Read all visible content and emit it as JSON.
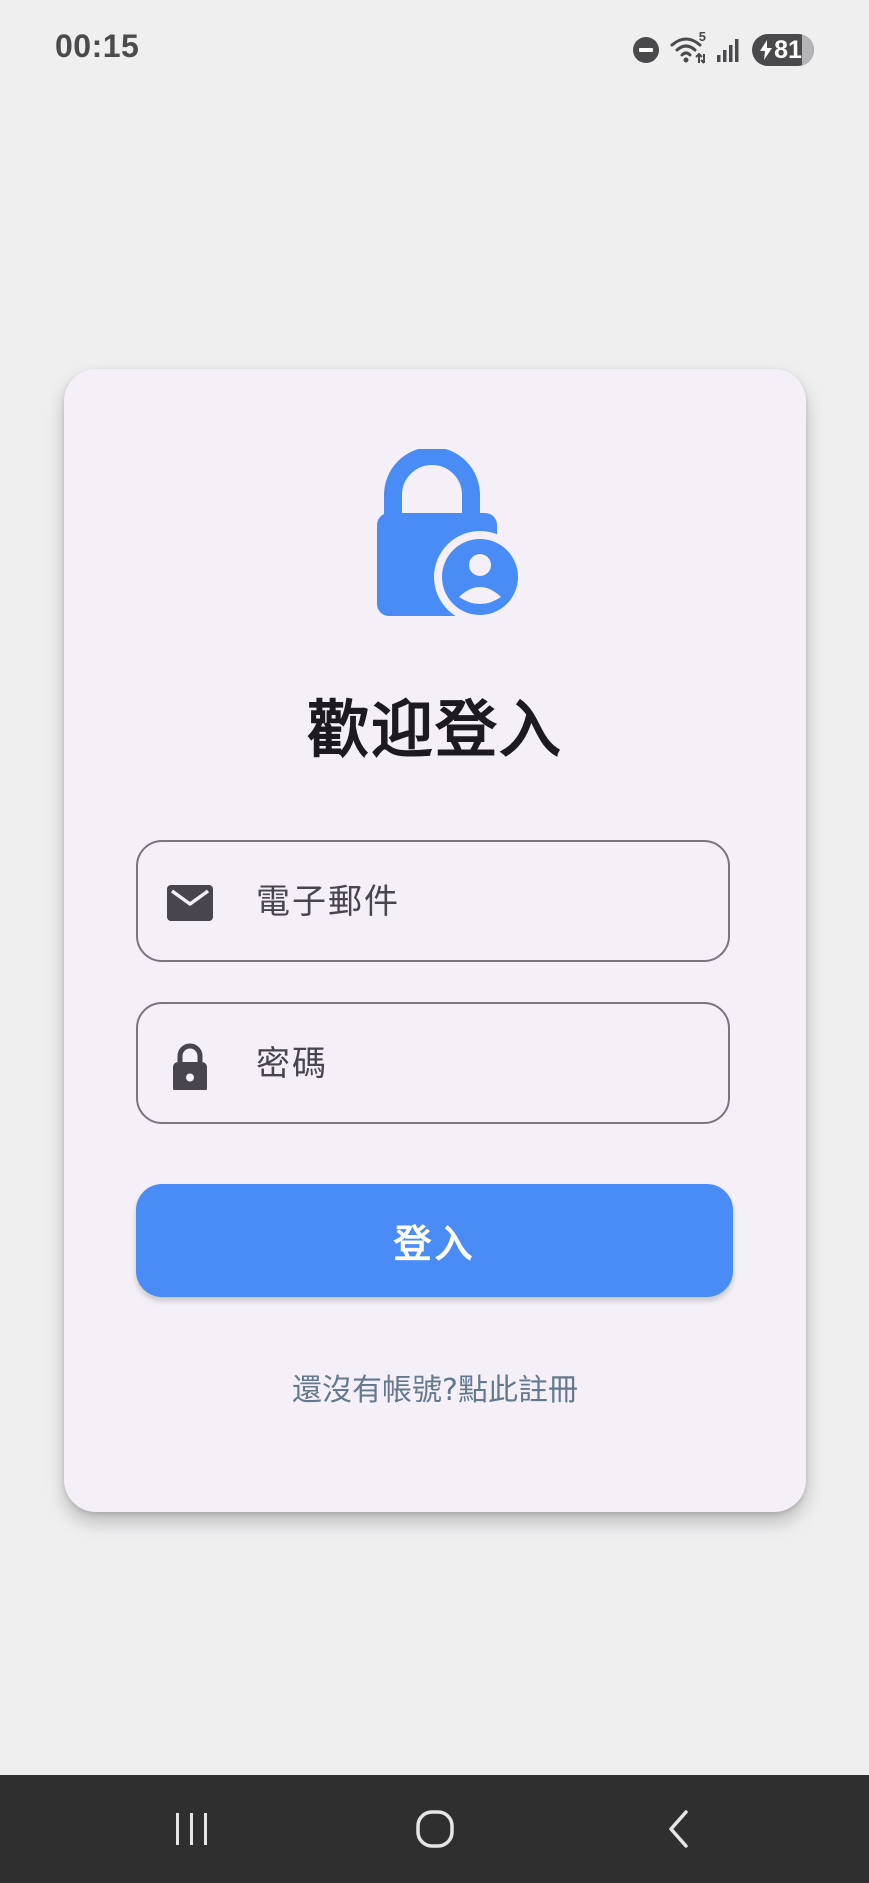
{
  "status_bar": {
    "time": "00:15",
    "icons": [
      "do-not-disturb-icon",
      "wifi-icon",
      "signal-icon",
      "battery-icon"
    ],
    "wifi_badge": "5",
    "battery_level": "81",
    "battery_charging": true
  },
  "login_card": {
    "logo_icon": "lock-account-icon",
    "title": "歡迎登入",
    "email_field": {
      "icon": "mail-icon",
      "placeholder": "電子郵件",
      "value": ""
    },
    "password_field": {
      "icon": "lock-icon",
      "placeholder": "密碼",
      "value": ""
    },
    "login_button_label": "登入",
    "register_link": "還沒有帳號?點此註冊"
  },
  "navigation_bar": {
    "buttons": [
      "recents-icon",
      "home-icon",
      "back-icon"
    ]
  },
  "colors": {
    "background": "#efeff0",
    "card": "#f5f0f8",
    "accent": "#4a8cf6",
    "title_text": "#1d1b1f",
    "link_text": "#64798e",
    "nav_bar": "#2f2f30"
  }
}
